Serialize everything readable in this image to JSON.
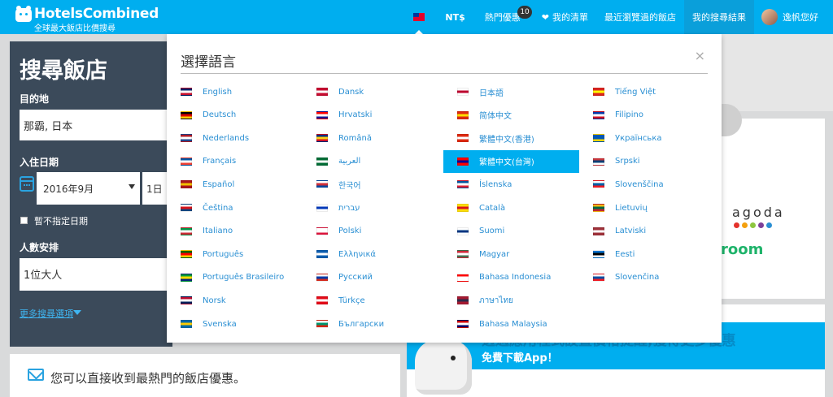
{
  "header": {
    "brand": "HotelsCombined",
    "tagline": "全球最大飯店比價搜尋",
    "currency": "NT$",
    "hot_deals": "熱門優惠",
    "hot_deals_count": "10",
    "wishlist": "我的清單",
    "recent_viewed": "最近瀏覽過的飯店",
    "my_results": "我的搜尋結果",
    "user": "逸帆您好"
  },
  "search": {
    "title": "搜尋飯店",
    "destination_label": "目的地",
    "destination_value": "那霸, 日本",
    "checkin_label": "入住日期",
    "month_value": "2016年9月",
    "day_value": "1日",
    "no_date_label": "暫不指定日期",
    "guests_label": "人數安排",
    "guests_value": "1位大人",
    "more_options": "更多搜尋選項"
  },
  "deals_card": {
    "text": "您可以直接收到最熱門的飯店優惠。"
  },
  "partners": {
    "agoda": "agoda",
    "agoda_dot_colors": [
      "#e4322b",
      "#f4a00e",
      "#8dc63f",
      "#7c3f98",
      "#2a8fd3"
    ],
    "room": "room"
  },
  "app_banner": {
    "blurred_text": "透過應用程式設置價格提醒,獲得更多優惠",
    "cta": "免費下載App！"
  },
  "language_modal": {
    "title": "選擇語言",
    "close": "×",
    "selected": "繁體中文(台灣)",
    "columns": [
      [
        "English",
        "Deutsch",
        "Nederlands",
        "Français",
        "Español",
        "Čeština",
        "Italiano",
        "Português",
        "Português Brasileiro",
        "Norsk",
        "Svenska"
      ],
      [
        "Dansk",
        "Hrvatski",
        "Română",
        "العربية",
        "한국어",
        "עברית",
        "Polski",
        "Ελληνικά",
        "Русский",
        "Türkçe",
        "Български"
      ],
      [
        "日本語",
        "简体中文",
        "繁體中文(香港)",
        "繁體中文(台灣)",
        "Íslenska",
        "Català",
        "Suomi",
        "Magyar",
        "Bahasa Indonesia",
        "ภาษาไทย",
        "Bahasa Malaysia"
      ],
      [
        "Tiếng Việt",
        "Filipino",
        "Українська",
        "Srpski",
        "Slovenščina",
        "Lietuvių",
        "Latviski",
        "Eesti",
        "Slovenčina"
      ]
    ],
    "flag_colors": [
      [
        [
          "#012169",
          "#ffffff",
          "#c8102e"
        ],
        [
          "#000000",
          "#dd0000",
          "#ffce00"
        ],
        [
          "#ae1c28",
          "#ffffff",
          "#21468b"
        ],
        [
          "#0055a4",
          "#ffffff",
          "#ef4135"
        ],
        [
          "#aa151b",
          "#f1bf00",
          "#aa151b"
        ],
        [
          "#ffffff",
          "#d7141a",
          "#11457e"
        ],
        [
          "#009246",
          "#ffffff",
          "#ce2b37"
        ],
        [
          "#006600",
          "#ff0000",
          "#ffcc00"
        ],
        [
          "#009c3b",
          "#ffdf00",
          "#002776"
        ],
        [
          "#ba0c2f",
          "#ffffff",
          "#00205b"
        ],
        [
          "#006aa7",
          "#fecc00",
          "#006aa7"
        ]
      ],
      [
        [
          "#c60c30",
          "#ffffff",
          "#c60c30"
        ],
        [
          "#ff0000",
          "#ffffff",
          "#171796"
        ],
        [
          "#002b7f",
          "#fcd116",
          "#ce1126"
        ],
        [
          "#006c35",
          "#ffffff",
          "#006c35"
        ],
        [
          "#ffffff",
          "#cd2e3a",
          "#0047a0"
        ],
        [
          "#ffffff",
          "#0038b8",
          "#ffffff"
        ],
        [
          "#ffffff",
          "#ffffff",
          "#dc143c"
        ],
        [
          "#0d5eaf",
          "#ffffff",
          "#0d5eaf"
        ],
        [
          "#ffffff",
          "#0039a6",
          "#d52b1e"
        ],
        [
          "#e30a17",
          "#ffffff",
          "#e30a17"
        ],
        [
          "#ffffff",
          "#00966e",
          "#d62612"
        ]
      ],
      [
        [
          "#ffffff",
          "#bc002d",
          "#ffffff"
        ],
        [
          "#de2910",
          "#ffde00",
          "#de2910"
        ],
        [
          "#de2910",
          "#ffffff",
          "#de2910"
        ],
        [
          "#fe0000",
          "#000095",
          "#fe0000"
        ],
        [
          "#02529c",
          "#ffffff",
          "#dc1e35"
        ],
        [
          "#fcdd09",
          "#da121a",
          "#fcdd09"
        ],
        [
          "#ffffff",
          "#003580",
          "#ffffff"
        ],
        [
          "#ce2939",
          "#ffffff",
          "#477050"
        ],
        [
          "#ff0000",
          "#ffffff",
          "#ffffff"
        ],
        [
          "#a51931",
          "#2d2a4a",
          "#a51931"
        ],
        [
          "#cc0001",
          "#ffffff",
          "#010066"
        ]
      ],
      [
        [
          "#da251d",
          "#ffff00",
          "#da251d"
        ],
        [
          "#0038a8",
          "#ffffff",
          "#ce1126"
        ],
        [
          "#0057b7",
          "#0057b7",
          "#ffd700"
        ],
        [
          "#c6363c",
          "#0c4076",
          "#ffffff"
        ],
        [
          "#ffffff",
          "#005da4",
          "#ed1c24"
        ],
        [
          "#fdb913",
          "#006a44",
          "#c1272d"
        ],
        [
          "#9e3039",
          "#ffffff",
          "#9e3039"
        ],
        [
          "#0072ce",
          "#000000",
          "#ffffff"
        ],
        [
          "#ffffff",
          "#0b4ea2",
          "#ee1c25"
        ]
      ]
    ]
  }
}
